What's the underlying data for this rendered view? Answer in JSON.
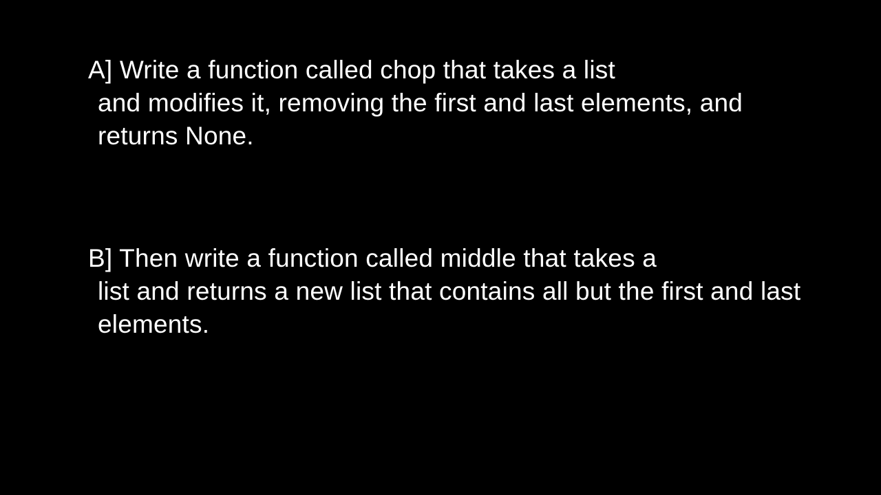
{
  "slide": {
    "paragraphA": {
      "firstLine": "A] Write a function called chop that takes a list",
      "continuation": "and modifies it, removing the first and last elements, and returns None."
    },
    "paragraphB": {
      "firstLine": "B] Then write a function called middle that takes a",
      "continuation": "list and returns a new list that contains all but the first and last elements."
    }
  }
}
